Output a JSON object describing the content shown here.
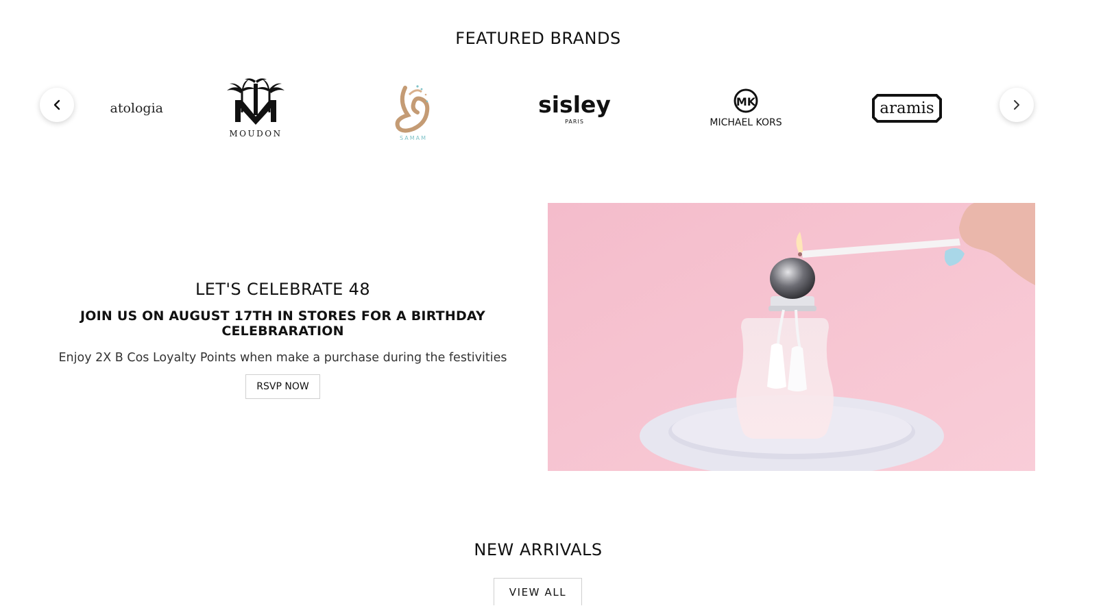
{
  "featured": {
    "title": "FEATURED BRANDS",
    "brands": [
      {
        "name": "atologia",
        "display": "atologia"
      },
      {
        "name": "moudon",
        "display": "MOUDON"
      },
      {
        "name": "samam",
        "display": "SAMAM"
      },
      {
        "name": "sisley",
        "display": "sisley",
        "sub": "PARIS"
      },
      {
        "name": "michael-kors",
        "display": "MICHAEL KORS",
        "monogram": "MK"
      },
      {
        "name": "aramis",
        "display": "aramis"
      }
    ],
    "prev_icon": "chevron-left-icon",
    "next_icon": "chevron-right-icon"
  },
  "promo": {
    "heading": "LET'S CELEBRATE 48",
    "subheading": "JOIN US ON AUGUST 17TH IN STORES FOR A BIRTHDAY CELEBRARATION",
    "description": "Enjoy 2X B Cos Loyalty Points when make a purchase during the festivities",
    "button_label": "RSVP NOW",
    "image_colors": {
      "background": "#f7c6d2",
      "plate": "#e9e8f1"
    }
  },
  "new_arrivals": {
    "title": "NEW ARRIVALS",
    "button_label": "VIEW ALL"
  }
}
